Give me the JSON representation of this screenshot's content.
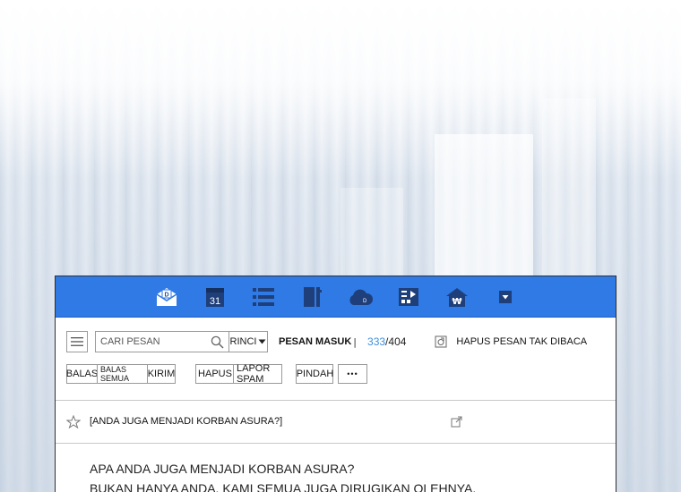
{
  "topbar": {
    "icons": [
      "mail-icon",
      "calendar-icon",
      "list-icon",
      "notebook-icon",
      "cloud-icon",
      "memo-icon",
      "wallet-icon",
      "dropdown-icon"
    ],
    "mail_badge": "D",
    "calendar_day": "31",
    "cloud_badge": "D",
    "wallet_symbol": "₩",
    "accent_color": "#2f7ae5"
  },
  "toolbar": {
    "search_placeholder": "CARI PESAN",
    "detail_label": "RINCI",
    "inbox_label": "PESAN MASUK",
    "inbox_separator": "|",
    "unread_count": "333",
    "count_slash": "/",
    "total_count": "404",
    "delete_unread_label": "HAPUS PESAN TAK DIBACA"
  },
  "actions": {
    "reply": "BALAS",
    "reply_all": "BALAS SEMUA",
    "send": "KIRIM",
    "delete": "HAPUS",
    "report_spam": "LAPOR SPAM",
    "move": "PINDAH",
    "more": "•••"
  },
  "message": {
    "subject": "[ANDA JUGA MENJADI KORBAN ASURA?]",
    "body_lines": [
      "APA ANDA JUGA MENJADI KORBAN ASURA?",
      "BUKAN HANYA ANDA. KAMI SEMUA JUGA DIRUGIKAN OLEHNYA."
    ]
  }
}
